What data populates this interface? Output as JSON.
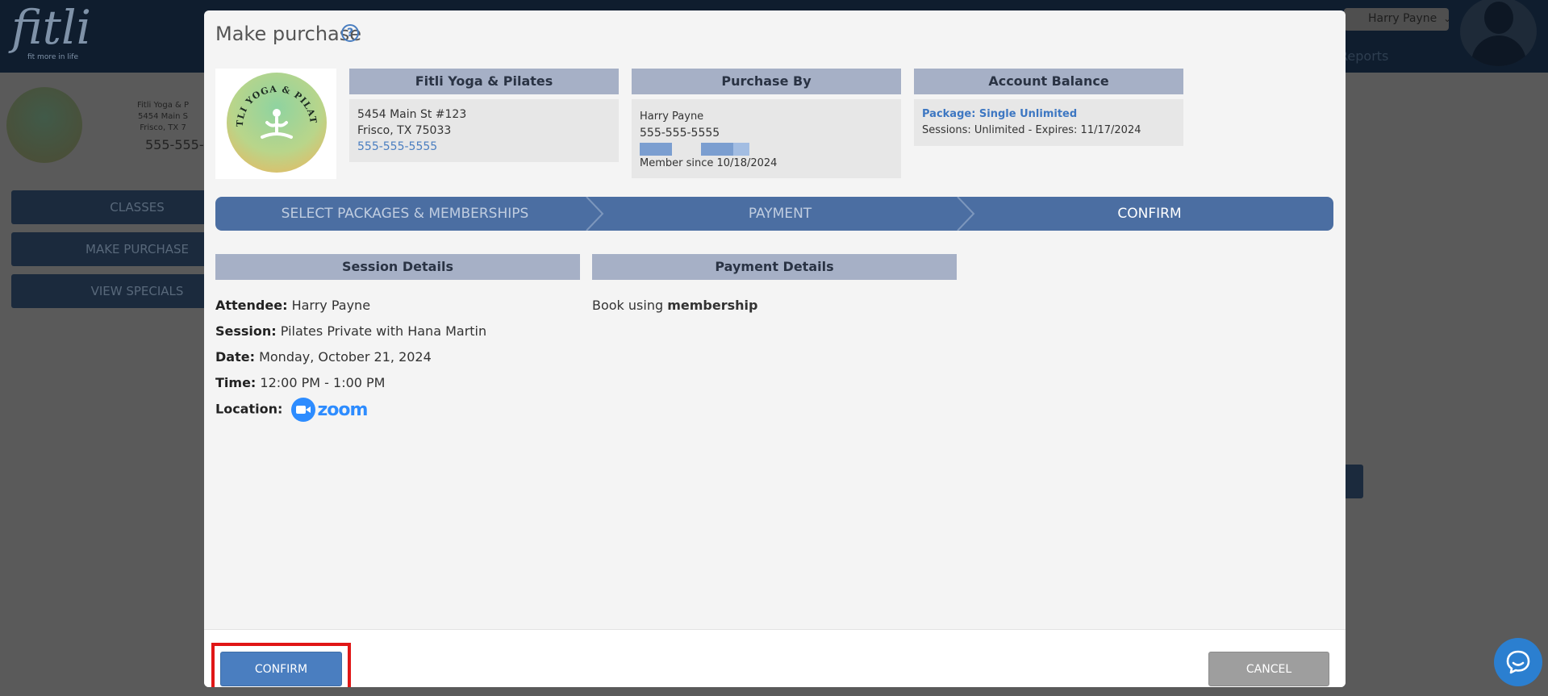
{
  "app": {
    "logo_word": "fitli",
    "logo_tagline": "fit more in life",
    "user_name": "Harry Payne",
    "reports_label": "Reports",
    "studio_info_lines": [
      "Fitli Yoga & P",
      "5454 Main S",
      "Frisco, TX 7"
    ],
    "studio_phone": "555-555-",
    "nav": [
      "CLASSES",
      "MAKE PURCHASE",
      "VIEW SPECIALS"
    ]
  },
  "modal": {
    "title": "Make purchase",
    "help_glyph": "?",
    "studio_card": {
      "header": "Fitli Yoga & Pilates",
      "address1": "5454 Main St #123",
      "address2": "Frisco, TX 75033",
      "phone": "555-555-5555",
      "logo_text": "FITLI YOGA & PILATES"
    },
    "purchase_by": {
      "header": "Purchase By",
      "name": "Harry Payne",
      "phone": "555-555-5555",
      "member_since": "Member since 10/18/2024"
    },
    "account_balance": {
      "header": "Account Balance",
      "package": "Package: Single Unlimited",
      "sessions": "Sessions: Unlimited - Expires: 11/17/2024"
    },
    "steps": [
      "SELECT PACKAGES & MEMBERSHIPS",
      "PAYMENT",
      "CONFIRM"
    ],
    "active_step": "CONFIRM",
    "session_details": {
      "header": "Session Details",
      "attendee_label": "Attendee:",
      "attendee": "Harry Payne",
      "session_label": "Session:",
      "session": "Pilates Private with Hana Martin",
      "date_label": "Date:",
      "date": "Monday, October 21, 2024",
      "time_label": "Time:",
      "time": "12:00 PM - 1:00 PM",
      "location_label": "Location:",
      "location_brand": "zoom"
    },
    "payment_details": {
      "header": "Payment Details",
      "text_prefix": "Book using",
      "text_bold": "membership"
    },
    "footer": {
      "confirm_label": "CONFIRM",
      "cancel_label": "CANCEL"
    }
  },
  "colors": {
    "accent": "#4a7ec0",
    "stepper": "#4b6ea2",
    "card_header": "#a6b0c6",
    "highlight": "#e01616",
    "cancel": "#9e9e9e"
  }
}
